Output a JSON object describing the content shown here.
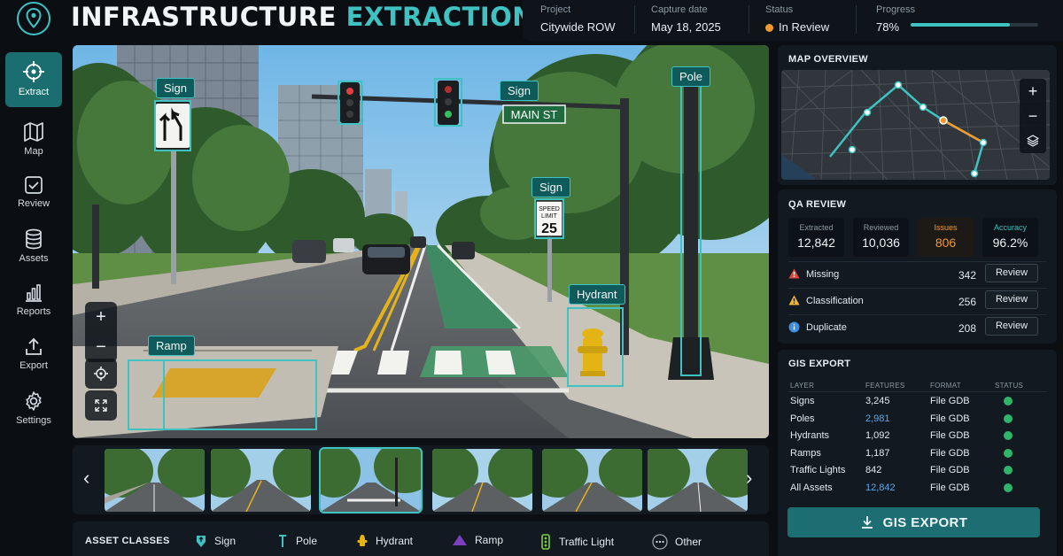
{
  "header": {
    "title_main": "INFRASTRUCTURE",
    "title_accent": "EXTRACTION",
    "project_label": "Project",
    "project_value": "Citywide ROW",
    "capture_label": "Capture date",
    "capture_value": "May 18, 2025",
    "status_label": "Status",
    "status_value": "In Review",
    "progress_label": "Progress",
    "progress_value": "78%",
    "progress_fraction": 0.78
  },
  "sidebar": {
    "items": [
      {
        "label": "Extract",
        "icon": "crosshair-icon"
      },
      {
        "label": "Map",
        "icon": "map-icon"
      },
      {
        "label": "Review",
        "icon": "check-square-icon"
      },
      {
        "label": "Assets",
        "icon": "database-icon"
      },
      {
        "label": "Reports",
        "icon": "bar-chart-icon"
      },
      {
        "label": "Export",
        "icon": "upload-icon"
      },
      {
        "label": "Settings",
        "icon": "gear-icon"
      }
    ]
  },
  "scene": {
    "labels": {
      "sign1": "Sign",
      "sign2": "Sign",
      "sign3": "Sign",
      "pole": "Pole",
      "hydrant": "Hydrant",
      "ramp": "Ramp"
    },
    "street_sign": "MAIN ST",
    "speed_sign": {
      "line1": "SPEED",
      "line2": "LIMIT",
      "value": "25"
    }
  },
  "map_overview": {
    "title": "MAP OVERVIEW"
  },
  "qa_review": {
    "title": "QA REVIEW",
    "stats": [
      {
        "label": "Extracted",
        "value": "12,842"
      },
      {
        "label": "Reviewed",
        "value": "10,036"
      },
      {
        "label": "Issues",
        "value": "806"
      },
      {
        "label": "Accuracy",
        "value": "96.2%"
      }
    ],
    "issues": [
      {
        "name": "Missing",
        "count": "342",
        "action": "Review"
      },
      {
        "name": "Classification",
        "count": "256",
        "action": "Review"
      },
      {
        "name": "Duplicate",
        "count": "208",
        "action": "Review"
      }
    ]
  },
  "gis_export": {
    "title": "GIS EXPORT",
    "headers": [
      "LAYER",
      "FEATURES",
      "FORMAT",
      "STATUS"
    ],
    "rows": [
      {
        "layer": "Signs",
        "features": "3,245",
        "format": "File GDB"
      },
      {
        "layer": "Poles",
        "features": "2,981",
        "format": "File GDB"
      },
      {
        "layer": "Hydrants",
        "features": "1,092",
        "format": "File GDB"
      },
      {
        "layer": "Ramps",
        "features": "1,187",
        "format": "File GDB"
      },
      {
        "layer": "Traffic Lights",
        "features": "842",
        "format": "File GDB"
      },
      {
        "layer": "All Assets",
        "features": "12,842",
        "format": "File GDB"
      }
    ],
    "button": "GIS EXPORT"
  },
  "asset_classes": {
    "title": "ASSET CLASSES",
    "items": [
      "Sign",
      "Pole",
      "Hydrant",
      "Ramp",
      "Traffic Light",
      "Other"
    ]
  },
  "colors": {
    "accent": "#3ec3c2",
    "issue": "#f29a2e",
    "info": "#3b8ee0",
    "ok": "#2fb56a",
    "alert": "#e0483c",
    "warn": "#f2b532"
  }
}
